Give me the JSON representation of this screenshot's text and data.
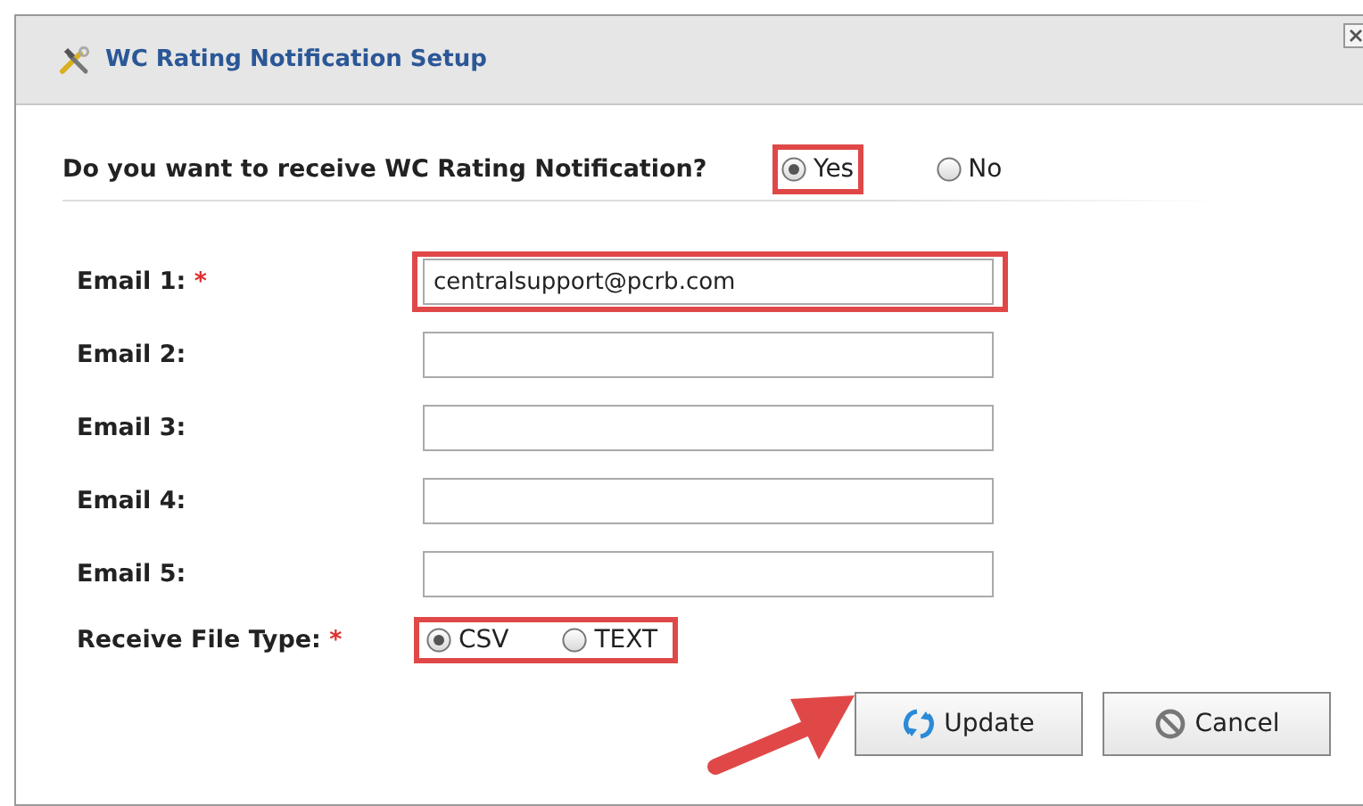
{
  "dialog": {
    "title": "WC Rating Notification Setup"
  },
  "question": {
    "label": "Do you want to receive WC Rating Notification?",
    "options": [
      {
        "label": "Yes",
        "selected": true,
        "highlighted": true
      },
      {
        "label": "No",
        "selected": false,
        "highlighted": false
      }
    ]
  },
  "emails": [
    {
      "label": "Email 1:",
      "required_mark": "*",
      "value": "centralsupport@pcrb.com",
      "highlighted": true
    },
    {
      "label": "Email 2:",
      "highlighted": false
    },
    {
      "label": "Email 3:",
      "highlighted": false
    },
    {
      "label": "Email 4:",
      "highlighted": false
    },
    {
      "label": "Email 5:",
      "highlighted": false
    }
  ],
  "file_type": {
    "label": "Receive File Type:",
    "required_mark": "*",
    "highlighted": true,
    "options": [
      {
        "label": "CSV",
        "selected": true
      },
      {
        "label": "TEXT",
        "selected": false
      }
    ]
  },
  "buttons": [
    {
      "label": "Update",
      "kind": "update",
      "pointed": true
    },
    {
      "label": "Cancel",
      "kind": "cancel",
      "pointed": false
    }
  ]
}
